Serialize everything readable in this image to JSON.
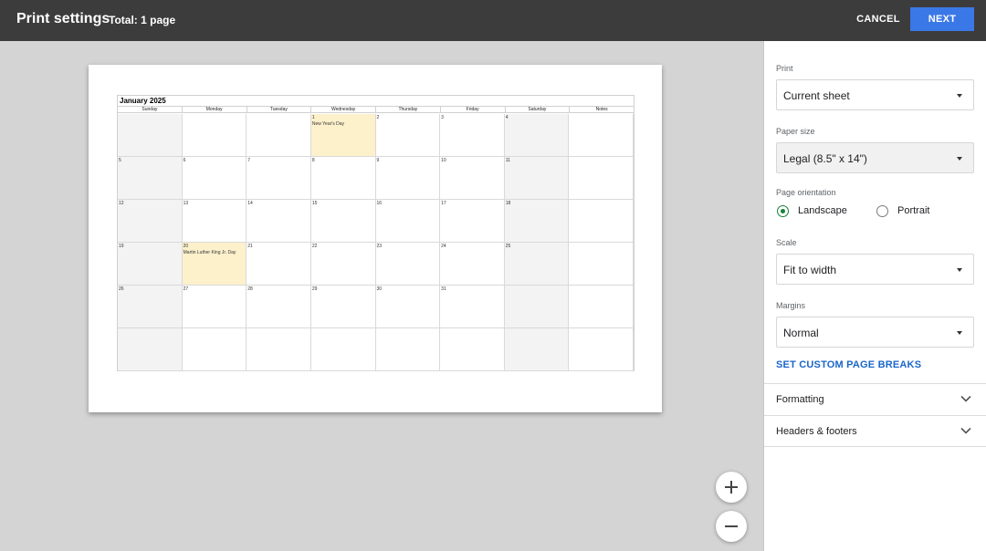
{
  "header": {
    "title": "Print settings",
    "total": "Total: 1 page",
    "cancel_label": "CANCEL",
    "next_label": "NEXT"
  },
  "calendar": {
    "title": "January 2025",
    "headers": [
      "Sunday",
      "Monday",
      "Tuesday",
      "Wednesday",
      "Thursday",
      "Friday",
      "Saturday",
      "Notes"
    ],
    "weeks": [
      [
        "",
        "",
        "",
        "1",
        "2",
        "3",
        "4",
        ""
      ],
      [
        "5",
        "6",
        "7",
        "8",
        "9",
        "10",
        "11",
        ""
      ],
      [
        "12",
        "13",
        "14",
        "15",
        "16",
        "17",
        "18",
        ""
      ],
      [
        "19",
        "20",
        "21",
        "22",
        "23",
        "24",
        "25",
        ""
      ],
      [
        "26",
        "27",
        "28",
        "29",
        "30",
        "31",
        "",
        ""
      ],
      [
        "",
        "",
        "",
        "",
        "",
        "",
        "",
        ""
      ]
    ],
    "events": [
      {
        "date": "1",
        "label": "New Year's Day"
      },
      {
        "date": "20",
        "label": "Martin Luther King Jr. Day"
      }
    ]
  },
  "zoom": {
    "in_icon": "plus-icon",
    "out_icon": "minus-icon"
  },
  "settings": {
    "print_label": "Print",
    "print_value": "Current sheet",
    "paper_label": "Paper size",
    "paper_value": "Legal (8.5\" x 14\")",
    "orientation_label": "Page orientation",
    "landscape_label": "Landscape",
    "portrait_label": "Portrait",
    "orientation_selected": "Landscape",
    "scale_label": "Scale",
    "scale_value": "Fit to width",
    "margins_label": "Margins",
    "margins_value": "Normal",
    "page_breaks_label": "SET CUSTOM PAGE BREAKS",
    "formatting_label": "Formatting",
    "headers_label": "Headers & footers"
  },
  "colors": {
    "topbar": "#3c3c3c",
    "next_button": "#3b78e7",
    "link": "#1a66c9",
    "radio_selected": "#188038",
    "holiday_fill": "#fdf1cc",
    "weekend_fill": "#f3f3f3"
  }
}
